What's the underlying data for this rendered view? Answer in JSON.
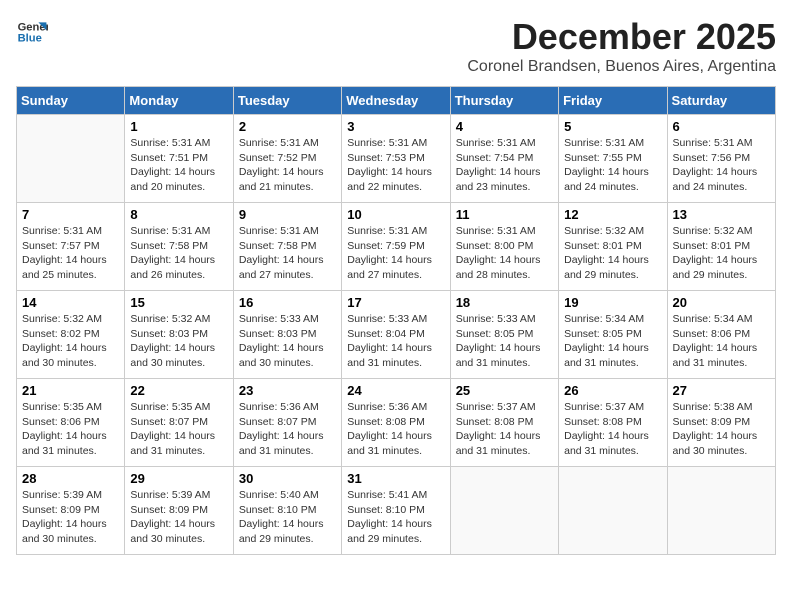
{
  "logo": {
    "line1": "General",
    "line2": "Blue"
  },
  "title": "December 2025",
  "subtitle": "Coronel Brandsen, Buenos Aires, Argentina",
  "days_of_week": [
    "Sunday",
    "Monday",
    "Tuesday",
    "Wednesday",
    "Thursday",
    "Friday",
    "Saturday"
  ],
  "weeks": [
    [
      {
        "day": "",
        "info": ""
      },
      {
        "day": "1",
        "info": "Sunrise: 5:31 AM\nSunset: 7:51 PM\nDaylight: 14 hours\nand 20 minutes."
      },
      {
        "day": "2",
        "info": "Sunrise: 5:31 AM\nSunset: 7:52 PM\nDaylight: 14 hours\nand 21 minutes."
      },
      {
        "day": "3",
        "info": "Sunrise: 5:31 AM\nSunset: 7:53 PM\nDaylight: 14 hours\nand 22 minutes."
      },
      {
        "day": "4",
        "info": "Sunrise: 5:31 AM\nSunset: 7:54 PM\nDaylight: 14 hours\nand 23 minutes."
      },
      {
        "day": "5",
        "info": "Sunrise: 5:31 AM\nSunset: 7:55 PM\nDaylight: 14 hours\nand 24 minutes."
      },
      {
        "day": "6",
        "info": "Sunrise: 5:31 AM\nSunset: 7:56 PM\nDaylight: 14 hours\nand 24 minutes."
      }
    ],
    [
      {
        "day": "7",
        "info": "Sunrise: 5:31 AM\nSunset: 7:57 PM\nDaylight: 14 hours\nand 25 minutes."
      },
      {
        "day": "8",
        "info": "Sunrise: 5:31 AM\nSunset: 7:58 PM\nDaylight: 14 hours\nand 26 minutes."
      },
      {
        "day": "9",
        "info": "Sunrise: 5:31 AM\nSunset: 7:58 PM\nDaylight: 14 hours\nand 27 minutes."
      },
      {
        "day": "10",
        "info": "Sunrise: 5:31 AM\nSunset: 7:59 PM\nDaylight: 14 hours\nand 27 minutes."
      },
      {
        "day": "11",
        "info": "Sunrise: 5:31 AM\nSunset: 8:00 PM\nDaylight: 14 hours\nand 28 minutes."
      },
      {
        "day": "12",
        "info": "Sunrise: 5:32 AM\nSunset: 8:01 PM\nDaylight: 14 hours\nand 29 minutes."
      },
      {
        "day": "13",
        "info": "Sunrise: 5:32 AM\nSunset: 8:01 PM\nDaylight: 14 hours\nand 29 minutes."
      }
    ],
    [
      {
        "day": "14",
        "info": "Sunrise: 5:32 AM\nSunset: 8:02 PM\nDaylight: 14 hours\nand 30 minutes."
      },
      {
        "day": "15",
        "info": "Sunrise: 5:32 AM\nSunset: 8:03 PM\nDaylight: 14 hours\nand 30 minutes."
      },
      {
        "day": "16",
        "info": "Sunrise: 5:33 AM\nSunset: 8:03 PM\nDaylight: 14 hours\nand 30 minutes."
      },
      {
        "day": "17",
        "info": "Sunrise: 5:33 AM\nSunset: 8:04 PM\nDaylight: 14 hours\nand 31 minutes."
      },
      {
        "day": "18",
        "info": "Sunrise: 5:33 AM\nSunset: 8:05 PM\nDaylight: 14 hours\nand 31 minutes."
      },
      {
        "day": "19",
        "info": "Sunrise: 5:34 AM\nSunset: 8:05 PM\nDaylight: 14 hours\nand 31 minutes."
      },
      {
        "day": "20",
        "info": "Sunrise: 5:34 AM\nSunset: 8:06 PM\nDaylight: 14 hours\nand 31 minutes."
      }
    ],
    [
      {
        "day": "21",
        "info": "Sunrise: 5:35 AM\nSunset: 8:06 PM\nDaylight: 14 hours\nand 31 minutes."
      },
      {
        "day": "22",
        "info": "Sunrise: 5:35 AM\nSunset: 8:07 PM\nDaylight: 14 hours\nand 31 minutes."
      },
      {
        "day": "23",
        "info": "Sunrise: 5:36 AM\nSunset: 8:07 PM\nDaylight: 14 hours\nand 31 minutes."
      },
      {
        "day": "24",
        "info": "Sunrise: 5:36 AM\nSunset: 8:08 PM\nDaylight: 14 hours\nand 31 minutes."
      },
      {
        "day": "25",
        "info": "Sunrise: 5:37 AM\nSunset: 8:08 PM\nDaylight: 14 hours\nand 31 minutes."
      },
      {
        "day": "26",
        "info": "Sunrise: 5:37 AM\nSunset: 8:08 PM\nDaylight: 14 hours\nand 31 minutes."
      },
      {
        "day": "27",
        "info": "Sunrise: 5:38 AM\nSunset: 8:09 PM\nDaylight: 14 hours\nand 30 minutes."
      }
    ],
    [
      {
        "day": "28",
        "info": "Sunrise: 5:39 AM\nSunset: 8:09 PM\nDaylight: 14 hours\nand 30 minutes."
      },
      {
        "day": "29",
        "info": "Sunrise: 5:39 AM\nSunset: 8:09 PM\nDaylight: 14 hours\nand 30 minutes."
      },
      {
        "day": "30",
        "info": "Sunrise: 5:40 AM\nSunset: 8:10 PM\nDaylight: 14 hours\nand 29 minutes."
      },
      {
        "day": "31",
        "info": "Sunrise: 5:41 AM\nSunset: 8:10 PM\nDaylight: 14 hours\nand 29 minutes."
      },
      {
        "day": "",
        "info": ""
      },
      {
        "day": "",
        "info": ""
      },
      {
        "day": "",
        "info": ""
      }
    ]
  ]
}
